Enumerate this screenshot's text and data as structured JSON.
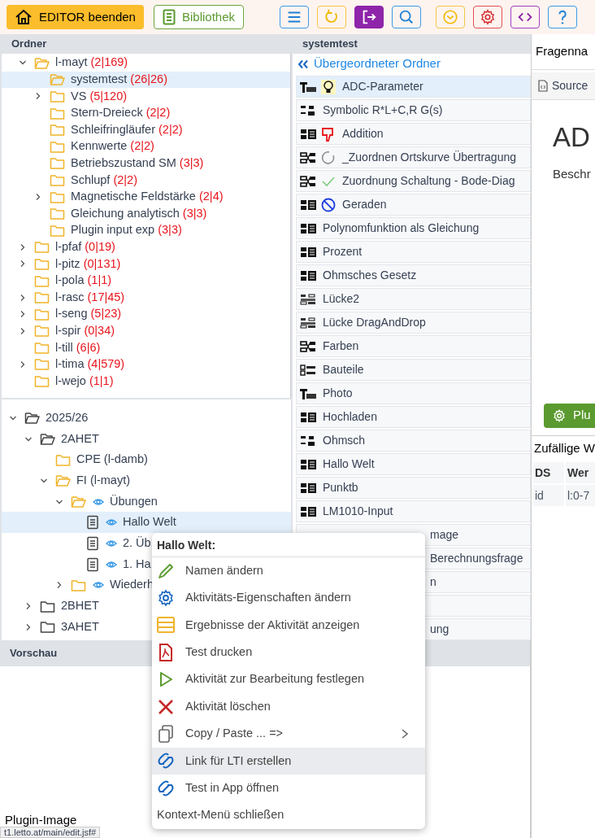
{
  "toolbar": {
    "buttons": [
      {
        "kind": "home",
        "label": "EDITOR beenden"
      },
      {
        "kind": "book",
        "label": "Bibliothek"
      }
    ],
    "icon_buttons": [
      {
        "kind": "menu"
      },
      {
        "kind": "refresh"
      },
      {
        "kind": "exit"
      },
      {
        "kind": "search"
      },
      {
        "kind": "chevron"
      },
      {
        "kind": "settings"
      },
      {
        "kind": "code"
      },
      {
        "kind": "help"
      }
    ]
  },
  "folders": {
    "title": "Ordner",
    "tree": [
      {
        "label": "l-mayt",
        "count": "(2|169)",
        "expandable": true,
        "expanded": true,
        "selected": false,
        "children": [
          {
            "label": "systemtest",
            "count": "(26|26)",
            "expandable": false,
            "expanded": false,
            "selected": true
          },
          {
            "label": "VS",
            "count": "(5|120)",
            "expandable": true,
            "expanded": false,
            "selected": false
          },
          {
            "label": "Stern-Dreieck",
            "count": "(2|2)",
            "expandable": false,
            "expanded": false,
            "selected": false
          },
          {
            "label": "Schleifringläufer",
            "count": "(2|2)",
            "expandable": false,
            "expanded": false,
            "selected": false
          },
          {
            "label": "Kennwerte",
            "count": "(2|2)",
            "expandable": false,
            "expanded": false,
            "selected": false
          },
          {
            "label": "Betriebszustand SM",
            "count": "(3|3)",
            "expandable": false,
            "expanded": false,
            "selected": false
          },
          {
            "label": "Schlupf",
            "count": "(2|2)",
            "expandable": false,
            "expanded": false,
            "selected": false
          },
          {
            "label": "Magnetische Feldstärke",
            "count": "(2|4)",
            "expandable": true,
            "expanded": false,
            "selected": false
          },
          {
            "label": "Gleichung analytisch",
            "count": "(3|3)",
            "expandable": false,
            "expanded": false,
            "selected": false
          },
          {
            "label": "Plugin input exp",
            "count": "(3|3)",
            "expandable": false,
            "expanded": false,
            "selected": false
          }
        ]
      },
      {
        "label": "l-pfaf",
        "count": "(0|19)",
        "expandable": true,
        "expanded": false,
        "selected": false
      },
      {
        "label": "l-pitz",
        "count": "(0|131)",
        "expandable": true,
        "expanded": false,
        "selected": false
      },
      {
        "label": "l-pola",
        "count": "(1|1)",
        "expandable": false,
        "expanded": false,
        "selected": false
      },
      {
        "label": "l-rasc",
        "count": "(17|45)",
        "expandable": true,
        "expanded": false,
        "selected": false
      },
      {
        "label": "l-seng",
        "count": "(5|23)",
        "expandable": true,
        "expanded": false,
        "selected": false
      },
      {
        "label": "l-spir",
        "count": "(0|34)",
        "expandable": true,
        "expanded": false,
        "selected": false
      },
      {
        "label": "l-till",
        "count": "(6|6)",
        "expandable": false,
        "expanded": false,
        "selected": false
      },
      {
        "label": "l-tima",
        "count": "(4|579)",
        "expandable": true,
        "expanded": false,
        "selected": false
      },
      {
        "label": "l-wejo",
        "count": "(1|1)",
        "expandable": false,
        "expanded": false,
        "selected": false
      }
    ]
  },
  "activities": {
    "tree": [
      {
        "kind": "class",
        "label": "2025/26",
        "expandable": true,
        "expanded": true,
        "selected": false,
        "children": [
          {
            "kind": "class",
            "label": "2AHET",
            "expandable": true,
            "expanded": true,
            "selected": false,
            "children": [
              {
                "kind": "folder",
                "label": "CPE (l-damb)",
                "expandable": false,
                "expanded": false,
                "selected": false
              },
              {
                "kind": "folder",
                "label": "FI (l-mayt)",
                "expandable": true,
                "expanded": true,
                "selected": false,
                "children": [
                  {
                    "kind": "folder",
                    "label": "Übungen",
                    "eye": true,
                    "expandable": true,
                    "expanded": true,
                    "selected": false,
                    "children": [
                      {
                        "kind": "document",
                        "label": "Hallo Welt",
                        "eye": true,
                        "selected": true
                      },
                      {
                        "kind": "document",
                        "label": "2. Üb",
                        "eye": true,
                        "selected": false
                      },
                      {
                        "kind": "document",
                        "label": "1. Ha",
                        "eye": true,
                        "selected": false
                      }
                    ]
                  },
                  {
                    "kind": "folder",
                    "label": "Wiederh",
                    "eye": true,
                    "expandable": true,
                    "expanded": false,
                    "selected": false
                  }
                ]
              }
            ]
          },
          {
            "kind": "class",
            "label": "2BHET",
            "expandable": true,
            "expanded": false,
            "selected": false
          },
          {
            "kind": "class",
            "label": "3AHET",
            "expandable": true,
            "expanded": false,
            "selected": false
          }
        ]
      }
    ]
  },
  "questions": {
    "title": "systemtest",
    "parent_link": "Übergeordneter Ordner",
    "items": [
      {
        "kind": "text",
        "badge": {
          "kind": "bulb"
        },
        "label": "ADC-Parameter",
        "selected": true
      },
      {
        "kind": "symbolic",
        "label": "Symbolic R*L+C,R G(s)",
        "selected": false
      },
      {
        "kind": "calc",
        "badge": {
          "kind": "thumbs-down"
        },
        "label": "Addition",
        "selected": false
      },
      {
        "kind": "match",
        "badge": {
          "kind": "circle"
        },
        "label": "_Zuordnen Ortskurve Übertragung",
        "selected": false
      },
      {
        "kind": "match",
        "badge": {
          "kind": "check"
        },
        "label": "Zuordnung Schaltung - Bode-Diag",
        "selected": false
      },
      {
        "kind": "calc",
        "badge": {
          "kind": "forbidden"
        },
        "label": "Geraden",
        "selected": false
      },
      {
        "kind": "calc",
        "label": "Polynomfunktion als Gleichung",
        "selected": false
      },
      {
        "kind": "calc",
        "label": "Prozent",
        "selected": false
      },
      {
        "kind": "calc",
        "label": "Ohmsches Gesetz",
        "selected": false
      },
      {
        "kind": "cloze",
        "label": "Lücke2",
        "selected": false
      },
      {
        "kind": "cloze",
        "label": "Lücke DragAndDrop",
        "selected": false
      },
      {
        "kind": "match",
        "label": "Farben",
        "selected": false
      },
      {
        "kind": "choice",
        "label": "Bauteile",
        "selected": false
      },
      {
        "kind": "text",
        "label": "Photo",
        "selected": false
      },
      {
        "kind": "calc",
        "label": "Hochladen",
        "selected": false
      },
      {
        "kind": "symbolic",
        "label": "Ohmsch",
        "selected": false
      },
      {
        "kind": "calc",
        "label": "Hallo Welt",
        "selected": false
      },
      {
        "kind": "calc",
        "label": "Punktb",
        "selected": false
      },
      {
        "kind": "calc",
        "label": "LM1010-Input",
        "selected": false
      },
      {
        "kind": "covered",
        "label": "mage",
        "selected": false
      },
      {
        "kind": "covered",
        "label": "Berechnungsfrage",
        "selected": false
      },
      {
        "kind": "covered",
        "label": "n",
        "selected": false
      },
      {
        "kind": "covered",
        "selected": false
      },
      {
        "kind": "covered",
        "label": "ung",
        "selected": false
      }
    ]
  },
  "detail": {
    "name_label": "Fragenna",
    "tab": "Source",
    "heading": "AD",
    "description": "Beschr",
    "plugin_button": "Plu",
    "random_title": "Zufällige W",
    "table": {
      "columns": [
        "DS",
        "Wer"
      ],
      "rows": [
        [
          "id",
          "l:0-7"
        ]
      ]
    }
  },
  "preview": {
    "title": "Vorschau",
    "plugin_label": "Plugin-Image",
    "status_url": "t1.letto.at/main/edit.jsf#"
  },
  "context_menu": {
    "title": "Hallo Welt:",
    "items": [
      {
        "kind": "pencil",
        "label": "Namen ändern",
        "highlighted": false
      },
      {
        "kind": "gear",
        "label": "Aktivitäts-Eigenschaften ändern",
        "highlighted": false
      },
      {
        "kind": "list",
        "label": "Ergebnisse der Aktivität anzeigen",
        "highlighted": false
      },
      {
        "kind": "pdf",
        "label": "Test drucken",
        "highlighted": false
      },
      {
        "kind": "play",
        "label": "Aktivität zur Bearbeitung festlegen",
        "highlighted": false
      },
      {
        "kind": "cross",
        "label": "Aktivität löschen",
        "highlighted": false
      },
      {
        "kind": "copy",
        "label": "Copy / Paste ... =>",
        "highlighted": false,
        "submenu": true
      },
      {
        "kind": "link",
        "label": "Link für LTI erstellen",
        "highlighted": true
      },
      {
        "kind": "link",
        "label": "Test in App öffnen",
        "highlighted": false
      },
      {
        "kind": "plain",
        "label": "Kontext-Menü schließen",
        "highlighted": false
      }
    ]
  }
}
